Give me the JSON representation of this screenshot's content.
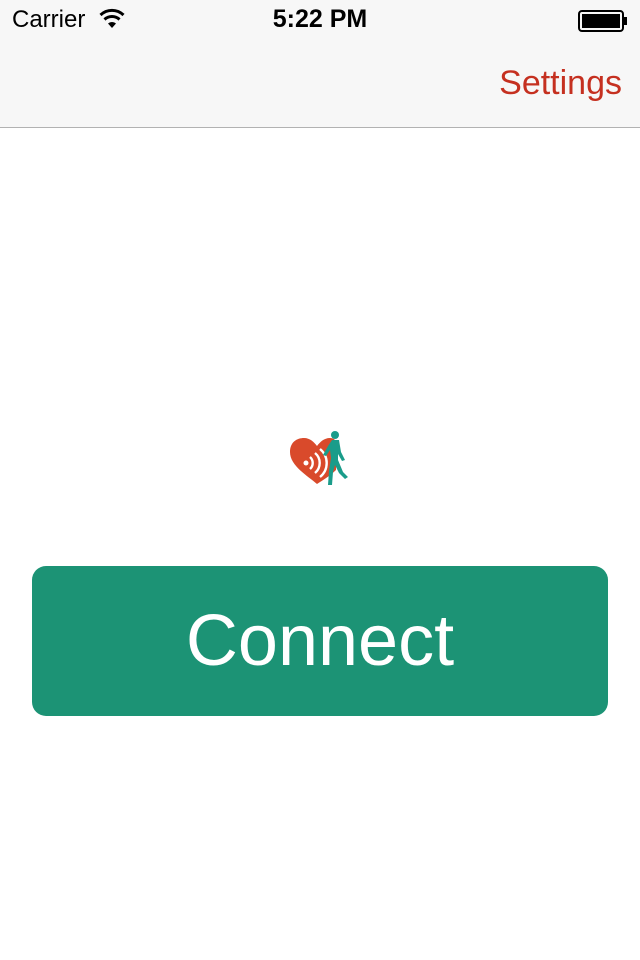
{
  "status_bar": {
    "carrier": "Carrier",
    "time": "5:22 PM",
    "wifi_icon": "wifi-icon",
    "battery_icon": "battery-full-icon"
  },
  "nav_bar": {
    "settings_label": "Settings"
  },
  "main": {
    "logo_icon": "heart-runner-logo",
    "connect_label": "Connect"
  },
  "colors": {
    "accent": "#c53020",
    "button": "#1c9375",
    "logo_heart": "#d94a2b",
    "logo_runner": "#1a9c8a",
    "navbar_bg": "#f7f7f7"
  }
}
